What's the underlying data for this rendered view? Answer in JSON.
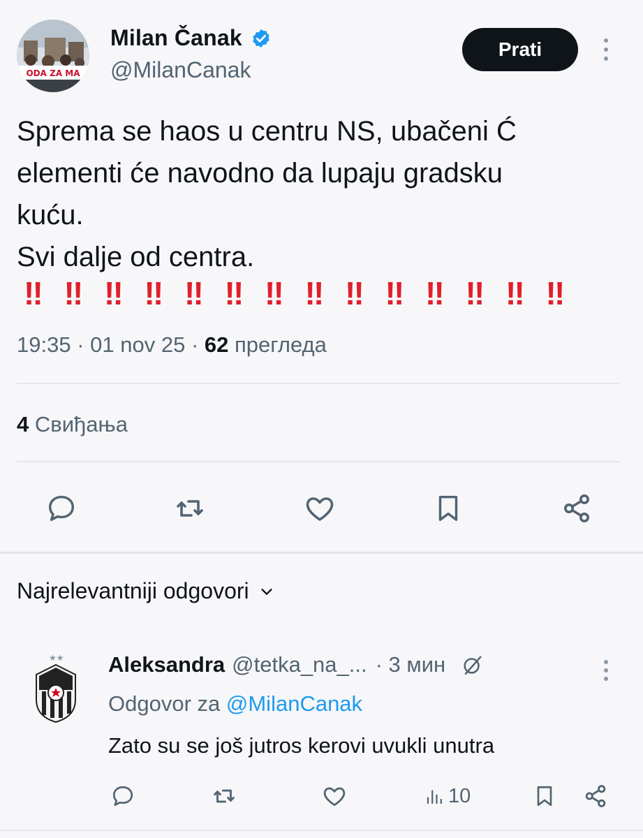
{
  "tweet": {
    "author_name": "Milan Čanak",
    "author_handle": "@MilanCanak",
    "avatar_banner_text": "ODA ZA MA",
    "follow_label": "Prati",
    "text_lines": [
      "Sprema se haos u centru NS, ubačeni Ć",
      "elementi će navodno da lupaju gradsku",
      "kuću.",
      "Svi dalje od centra."
    ],
    "emphasis": "‼",
    "emphasis_count": 14,
    "time": "19:35",
    "date": "01 nov 25",
    "views_count": "62",
    "views_label": "прегледа",
    "likes_count": "4",
    "likes_label": "Свиђања"
  },
  "actions": {
    "icons": [
      "reply-icon",
      "retweet-icon",
      "like-icon",
      "bookmark-icon",
      "share-icon"
    ]
  },
  "replies_section": {
    "title": "Najrelevantniji odgovori"
  },
  "reply": {
    "name": "Aleksandra",
    "handle": "@tetka_na_...",
    "time": "· 3 мин",
    "reply_to_prefix": "Odgovor za",
    "reply_to_handle": "@MilanCanak",
    "text": "Zato su se još jutros kerovi uvukli unutra",
    "views": "10"
  },
  "colors": {
    "accent": "#1d9bf0",
    "text": "#0f1419",
    "muted": "#536471",
    "emphasis": "#e0202a",
    "background": "#f7f7f9"
  }
}
